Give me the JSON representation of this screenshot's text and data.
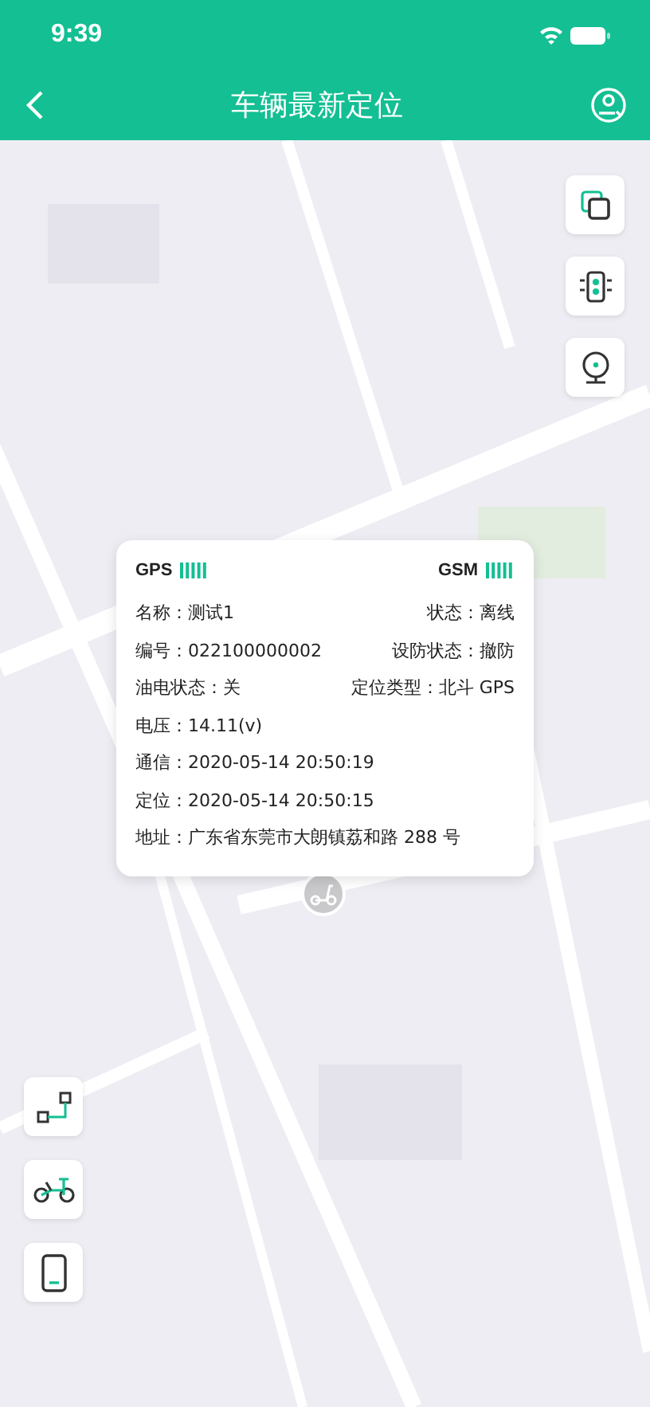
{
  "status_bar": {
    "time": "9:39"
  },
  "header": {
    "title": "车辆最新定位"
  },
  "info_card": {
    "gps_label": "GPS",
    "gsm_label": "GSM",
    "rows": [
      {
        "left": {
          "label": "名称：",
          "value": "测试1"
        },
        "right": {
          "label": "状态：",
          "value": "离线"
        }
      },
      {
        "left": {
          "label": "编号：",
          "value": "022100000002"
        },
        "right": {
          "label": "设防状态：",
          "value": "撤防"
        }
      },
      {
        "left": {
          "label": "油电状态：",
          "value": "关"
        },
        "right": {
          "label": "定位类型：",
          "value": "北斗 GPS"
        }
      },
      {
        "left": {
          "label": "电压：",
          "value": "14.11(v)"
        }
      },
      {
        "left": {
          "label": "通信：",
          "value": "2020-05-14 20:50:19"
        }
      },
      {
        "left": {
          "label": "定位：",
          "value": "2020-05-14 20:50:15"
        }
      },
      {
        "left": {
          "label": "地址：",
          "value": "广东省东莞市大朗镇荔和路 288 号"
        }
      }
    ]
  },
  "right_tools": [
    {
      "kind": "layers"
    },
    {
      "kind": "traffic"
    },
    {
      "kind": "camera"
    }
  ],
  "left_tools": [
    {
      "kind": "route"
    },
    {
      "kind": "bike"
    },
    {
      "kind": "phone"
    }
  ]
}
